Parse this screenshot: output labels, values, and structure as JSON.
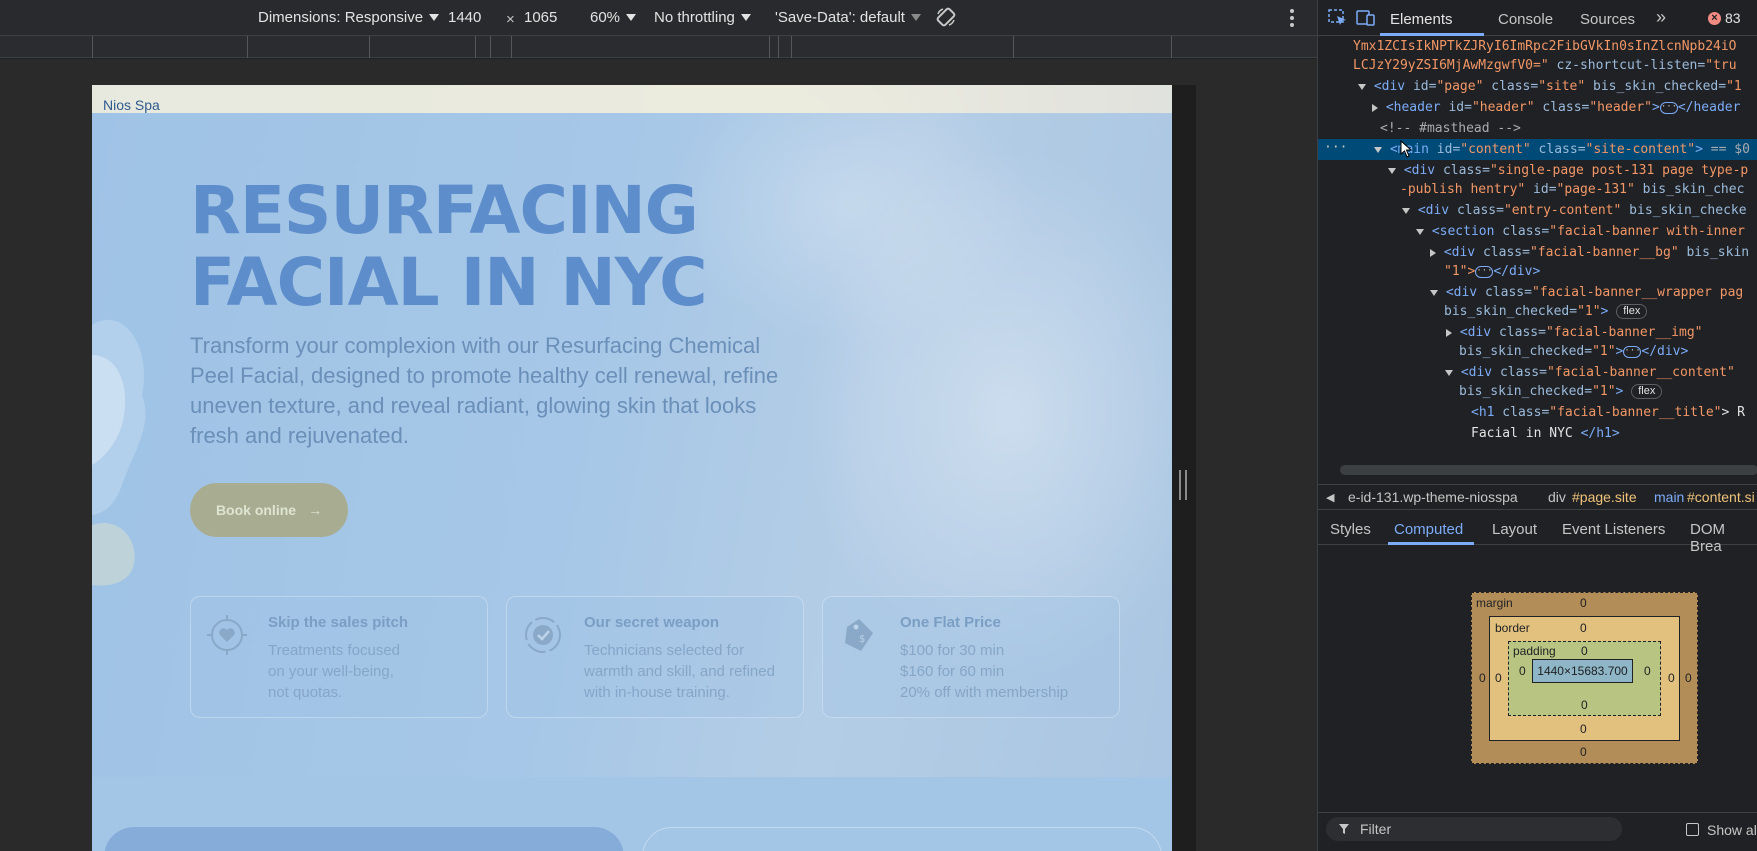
{
  "device_toolbar": {
    "dimensions_label": "Dimensions: Responsive",
    "width": "1440",
    "times": "×",
    "height": "1065",
    "zoom": "60%",
    "throttling": "No throttling",
    "save_data": "'Save-Data': default"
  },
  "page": {
    "logo": "Nios Spa",
    "hero_title": "RESURFACING FACIAL IN NYC",
    "hero_text": "Transform your complexion with our Resurfacing Chemical Peel Facial, designed to promote healthy cell renewal, refine uneven texture, and reveal radiant, glowing skin that looks fresh and rejuvenated.",
    "book_button": "Book online",
    "arrow": "→",
    "cards": [
      {
        "title": "Skip the sales pitch",
        "body": "Treatments focused\non your well-being,\nnot quotas.",
        "icon": "heart-target-icon"
      },
      {
        "title": "Our secret weapon",
        "body": "Technicians selected for\nwarmth and skill, and refined\nwith in-house training.",
        "icon": "check-badge-icon"
      },
      {
        "title": "One Flat Price",
        "body": "$100 for 30 min\n$160 for 60 min\n20% off with membership",
        "icon": "price-tag-icon"
      }
    ]
  },
  "devtools": {
    "tabs": [
      "Elements",
      "Console",
      "Sources"
    ],
    "more_tabs": "»",
    "error_count": "83",
    "dom_lines": {
      "l1": "Ymx1ZCIsIkNPTkZJRyI6ImRpc2FibGVkIn0sInZlcnNpb24iO",
      "l2a": "LCJzY29yZSI6MjAwMzgwfV0=\"",
      "l2b": " cz-shortcut-listen=",
      "l2c": "\"tru",
      "l3": {
        "tag": "<div",
        "a1": " id=",
        "v1": "\"page\"",
        "a2": " class=",
        "v2": "\"site\"",
        "a3": " bis_skin_checked=",
        "v3": "\"1"
      },
      "l4": {
        "tag": "<header",
        "a1": " id=",
        "v1": "\"header\"",
        "a2": " class=",
        "v2": "\"header\"",
        "close": "</header"
      },
      "l5": "<!-- #masthead -->",
      "l6": {
        "tag": "<main",
        "a1": " id=",
        "v1": "\"content\"",
        "a2": " class=",
        "v2": "\"site-content\"",
        "eq": " == $0"
      },
      "l7": {
        "tag": "<div",
        "a1": " class=",
        "v1": "\"single-page post-131 page type-p"
      },
      "l8": {
        "v0": "-publish hentry\"",
        "a1": " id=",
        "v1": "\"page-131\"",
        "a2": " bis_skin_chec"
      },
      "l9": {
        "tag": "<div",
        "a1": " class=",
        "v1": "\"entry-content\"",
        "a2": " bis_skin_checke"
      },
      "l10": {
        "tag": "<section",
        "a1": " class=",
        "v1": "\"facial-banner with-inner"
      },
      "l11": {
        "tag": "<div",
        "a1": " class=",
        "v1": "\"facial-banner__bg\"",
        "a2": " bis_skin"
      },
      "l12": {
        "v0": "\"1\">",
        "close": "</div>"
      },
      "l13": {
        "tag": "<div",
        "a1": " class=",
        "v1": "\"facial-banner__wrapper pag"
      },
      "l14": {
        "a1": "bis_skin_checked=",
        "v1": "\"1\"",
        "gt": ">",
        "badge": "flex"
      },
      "l15": {
        "tag": "<div",
        "a1": " class=",
        "v1": "\"facial-banner__img\""
      },
      "l16": {
        "a1": "bis_skin_checked=",
        "v1": "\"1\"",
        "gt": ">",
        "close": "</div>"
      },
      "l17": {
        "tag": "<div",
        "a1": " class=",
        "v1": "\"facial-banner__content\""
      },
      "l18": {
        "a1": "bis_skin_checked=",
        "v1": "\"1\"",
        "gt": ">",
        "badge": "flex"
      },
      "l19": {
        "tag": "<h1",
        "a1": " class=",
        "v1": "\"facial-banner__title\"",
        "text": "> R"
      },
      "l20": {
        "text": "Facial in NYC ",
        "close": "</h1>"
      }
    },
    "breadcrumbs": [
      "e-id-131.wp-theme-niosspa",
      "div",
      "#page.site",
      "main",
      "#content.si"
    ],
    "subtabs": [
      "Styles",
      "Computed",
      "Layout",
      "Event Listeners",
      "DOM Brea"
    ],
    "box_model": {
      "margin_label": "margin",
      "border_label": "border",
      "padding_label": "padding",
      "zero": "0",
      "content": "1440×15683.700"
    },
    "filter_placeholder": "Filter",
    "show_all": "Show al"
  },
  "colors": {
    "accent": "#7cacf8",
    "hero_title": "#5d8dcb",
    "button": "#a8ad92"
  }
}
